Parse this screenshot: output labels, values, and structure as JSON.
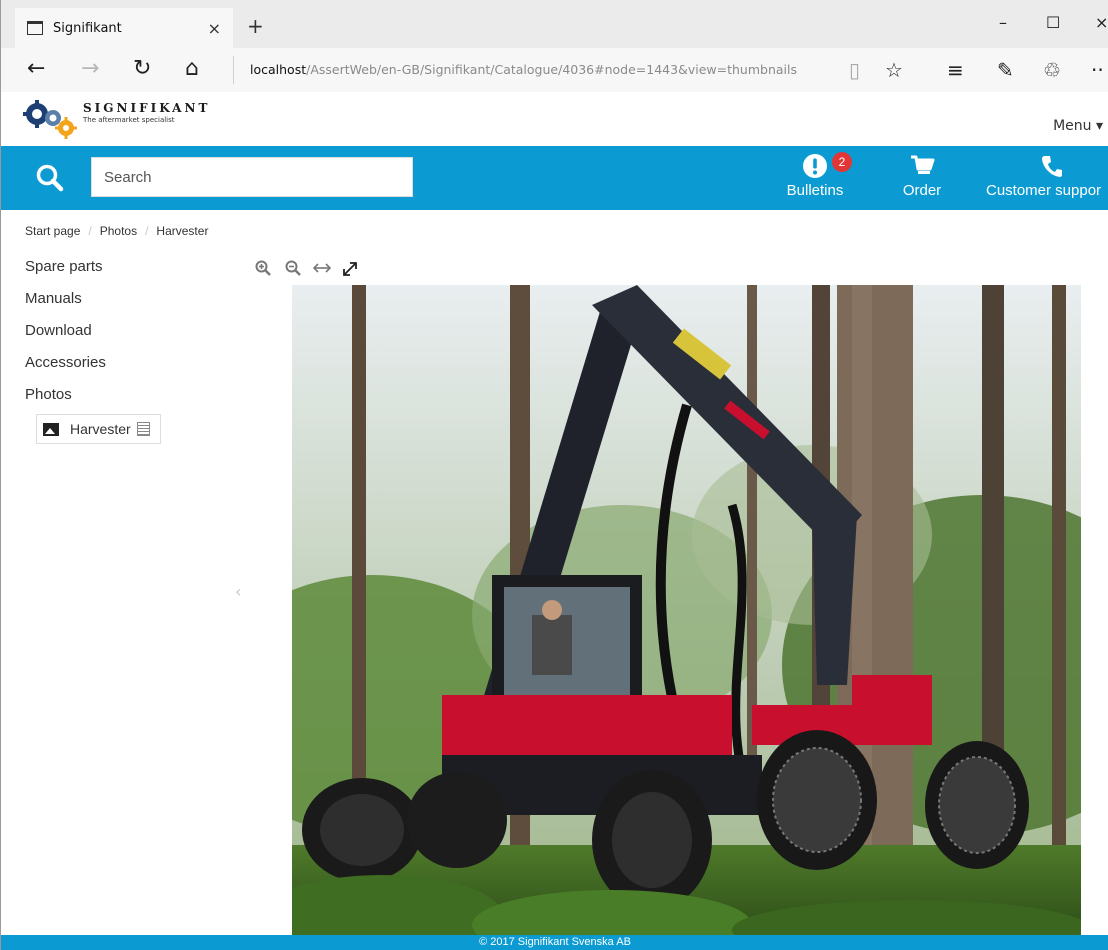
{
  "browser": {
    "tab_title": "Signifikant",
    "tab_close": "×",
    "new_tab": "+",
    "address_host": "localhost",
    "address_path": "/AssertWeb/en-GB/Signifikant/Catalogue/4036#node=1443&view=thumbnails",
    "window": {
      "minimize": "–",
      "maximize": "☐",
      "close": "×"
    },
    "nav": {
      "back": "←",
      "forward": "→",
      "refresh": "↻",
      "home": "⌂"
    },
    "tools": {
      "reading": "▯",
      "favorite": "☆",
      "hub": "≡",
      "note": "✎",
      "share": "♲",
      "more": "··"
    }
  },
  "site": {
    "brand_name": "SIGNIFIKANT",
    "brand_tagline": "The aftermarket specialist",
    "menu_label": "Menu ▾",
    "search_placeholder": "Search",
    "actions": [
      {
        "label": "Bulletins",
        "badge": "2"
      },
      {
        "label": "Order"
      },
      {
        "label": "Customer suppor"
      }
    ],
    "breadcrumb": [
      "Start page",
      "Photos",
      "Harvester"
    ],
    "sidebar": [
      "Spare parts",
      "Manuals",
      "Download",
      "Accessories",
      "Photos"
    ],
    "sub_item": "Harvester",
    "collapse_glyph": "‹",
    "footer": "© 2017 Signifikant Svenska AB",
    "colors": {
      "primary": "#0b9bd2",
      "badge": "#e23636",
      "machine_red": "#c8102e"
    }
  }
}
